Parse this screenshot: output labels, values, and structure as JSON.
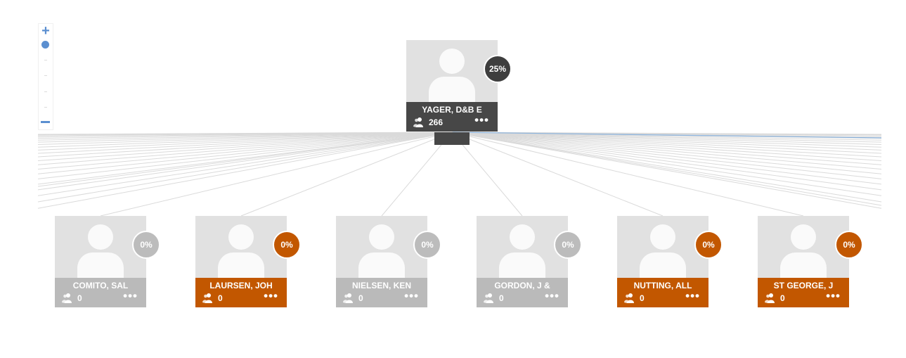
{
  "zoom": {
    "plus_icon": "plus-icon",
    "minus_icon": "minus-icon",
    "level": 1
  },
  "root": {
    "name": "YAGER, D&B E",
    "count": "266",
    "percent": "25%",
    "more": "•••",
    "bar_color": "#474747",
    "badge_color": "#3e3e3e"
  },
  "children": [
    {
      "name": "COMITO, SAL",
      "count": "0",
      "percent": "0%",
      "more": "•••",
      "bar_color": "#bababa",
      "badge_color": "#bcbcbc"
    },
    {
      "name": "LAURSEN, JOH",
      "count": "0",
      "percent": "0%",
      "more": "•••",
      "bar_color": "#c25700",
      "badge_color": "#c25700"
    },
    {
      "name": "NIELSEN, KEN",
      "count": "0",
      "percent": "0%",
      "more": "•••",
      "bar_color": "#bababa",
      "badge_color": "#bcbcbc"
    },
    {
      "name": "GORDON, J &",
      "count": "0",
      "percent": "0%",
      "more": "•••",
      "bar_color": "#bababa",
      "badge_color": "#bcbcbc"
    },
    {
      "name": "NUTTING, ALL",
      "count": "0",
      "percent": "0%",
      "more": "•••",
      "bar_color": "#c25700",
      "badge_color": "#c25700"
    },
    {
      "name": "ST GEORGE, J",
      "count": "0",
      "percent": "0%",
      "more": "•••",
      "bar_color": "#c25700",
      "badge_color": "#c25700"
    }
  ],
  "colors": {
    "link": "#dadada",
    "link_accent": "#8cb4de",
    "zoom": "#5b8fd0"
  }
}
